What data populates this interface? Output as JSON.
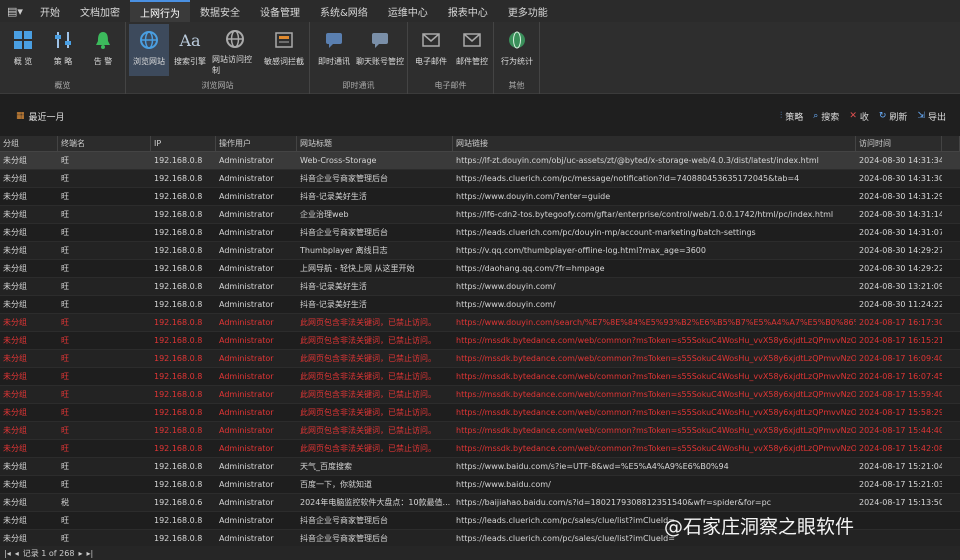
{
  "menu": {
    "items": [
      {
        "label": "开始",
        "active": false
      },
      {
        "label": "文档加密",
        "active": false
      },
      {
        "label": "上网行为",
        "active": true
      },
      {
        "label": "数据安全",
        "active": false
      },
      {
        "label": "设备管理",
        "active": false
      },
      {
        "label": "系统&网络",
        "active": false
      },
      {
        "label": "运维中心",
        "active": false
      },
      {
        "label": "报表中心",
        "active": false
      },
      {
        "label": "更多功能",
        "active": false
      }
    ]
  },
  "ribbon": {
    "groups": [
      {
        "label": "概览",
        "buttons": [
          {
            "label": "概 览",
            "icon": "grid-icon"
          },
          {
            "label": "策 略",
            "icon": "sliders-icon"
          },
          {
            "label": "告 警",
            "icon": "bell-icon"
          }
        ]
      },
      {
        "label": "浏览网站",
        "buttons": [
          {
            "label": "浏览网站",
            "icon": "globe-icon",
            "selected": true
          },
          {
            "label": "搜索引擎",
            "icon": "font-icon"
          },
          {
            "label": "网站访问控制",
            "icon": "globe-lock-icon"
          },
          {
            "label": "敏感词拦截",
            "icon": "filter-icon"
          }
        ]
      },
      {
        "label": "即时通讯",
        "buttons": [
          {
            "label": "即时通讯",
            "icon": "chat-icon"
          },
          {
            "label": "聊天账号管控",
            "icon": "chat-control-icon"
          }
        ]
      },
      {
        "label": "电子邮件",
        "buttons": [
          {
            "label": "电子邮件",
            "icon": "mail-icon"
          },
          {
            "label": "邮件管控",
            "icon": "mail-control-icon"
          }
        ]
      },
      {
        "label": "其他",
        "buttons": [
          {
            "label": "行为统计",
            "icon": "stats-globe-icon"
          }
        ]
      }
    ]
  },
  "toolbar": {
    "range_label": "最近一月",
    "strategy_label": "策略",
    "search_label": "搜索",
    "clear_label": "收",
    "refresh_label": "刷新",
    "export_label": "导出"
  },
  "table": {
    "headers": [
      "分组",
      "终端名",
      "IP",
      "操作用户",
      "网站标题",
      "网站链接",
      "访问时间"
    ],
    "rows": [
      {
        "group": "未分组",
        "term": "旺",
        "ip": "192.168.0.8",
        "user": "Administrator",
        "title": "Web-Cross-Storage",
        "url": "https://lf-zt.douyin.com/obj/uc-assets/zt/@byted/x-storage-web/4.0.3/dist/latest/index.html",
        "time": "2024-08-30 14:31:34",
        "style": "sel"
      },
      {
        "group": "未分组",
        "term": "旺",
        "ip": "192.168.0.8",
        "user": "Administrator",
        "title": "抖音企业号商家管理后台",
        "url": "https://leads.cluerich.com/pc/message/notification?id=740880453635172045&tab=4",
        "time": "2024-08-30 14:31:30",
        "style": ""
      },
      {
        "group": "未分组",
        "term": "旺",
        "ip": "192.168.0.8",
        "user": "Administrator",
        "title": "抖音-记录美好生活",
        "url": "https://www.douyin.com/?enter=guide",
        "time": "2024-08-30 14:31:29",
        "style": ""
      },
      {
        "group": "未分组",
        "term": "旺",
        "ip": "192.168.0.8",
        "user": "Administrator",
        "title": "企业治理web",
        "url": "https://lf6-cdn2-tos.bytegoofy.com/gftar/enterprise/control/web/1.0.0.1742/html/pc/index.html",
        "time": "2024-08-30 14:31:14",
        "style": ""
      },
      {
        "group": "未分组",
        "term": "旺",
        "ip": "192.168.0.8",
        "user": "Administrator",
        "title": "抖音企业号商家管理后台",
        "url": "https://leads.cluerich.com/pc/douyin-mp/account-marketing/batch-settings",
        "time": "2024-08-30 14:31:07",
        "style": ""
      },
      {
        "group": "未分组",
        "term": "旺",
        "ip": "192.168.0.8",
        "user": "Administrator",
        "title": "Thumbplayer 离线日志",
        "url": "https://v.qq.com/thumbplayer-offline-log.html?max_age=3600",
        "time": "2024-08-30 14:29:27",
        "style": ""
      },
      {
        "group": "未分组",
        "term": "旺",
        "ip": "192.168.0.8",
        "user": "Administrator",
        "title": "上网导航 - 轻快上网 从这里开始",
        "url": "https://daohang.qq.com/?fr=hmpage",
        "time": "2024-08-30 14:29:22",
        "style": ""
      },
      {
        "group": "未分组",
        "term": "旺",
        "ip": "192.168.0.8",
        "user": "Administrator",
        "title": "抖音-记录美好生活",
        "url": "https://www.douyin.com/",
        "time": "2024-08-30 13:21:09",
        "style": ""
      },
      {
        "group": "未分组",
        "term": "旺",
        "ip": "192.168.0.8",
        "user": "Administrator",
        "title": "抖音-记录美好生活",
        "url": "https://www.douyin.com/",
        "time": "2024-08-30 11:24:22",
        "style": ""
      },
      {
        "group": "未分组",
        "term": "旺",
        "ip": "192.168.0.8",
        "user": "Administrator",
        "title": "此网页包含非法关键词，已禁止访问。",
        "url": "https://www.douyin.com/search/%E7%8E%84%E5%93%B2%E6%B5%B7%E5%A4%A7%E5%B0%86%E6...",
        "time": "2024-08-17 16:17:30",
        "style": "warn"
      },
      {
        "group": "未分组",
        "term": "旺",
        "ip": "192.168.0.8",
        "user": "Administrator",
        "title": "此网页包含非法关键词，已禁止访问。",
        "url": "https://mssdk.bytedance.com/web/common?msToken=s55SokuC4WosHu_vvX58y6xjdtLzQPmvvNzO...",
        "time": "2024-08-17 16:15:21",
        "style": "warn"
      },
      {
        "group": "未分组",
        "term": "旺",
        "ip": "192.168.0.8",
        "user": "Administrator",
        "title": "此网页包含非法关键词，已禁止访问。",
        "url": "https://mssdk.bytedance.com/web/common?msToken=s55SokuC4WosHu_vvX58y6xjdtLzQPmvvNzO...",
        "time": "2024-08-17 16:09:40",
        "style": "warn"
      },
      {
        "group": "未分组",
        "term": "旺",
        "ip": "192.168.0.8",
        "user": "Administrator",
        "title": "此网页包含非法关键词，已禁止访问。",
        "url": "https://mssdk.bytedance.com/web/common?msToken=s55SokuC4WosHu_vvX58y6xjdtLzQPmvvNzO...",
        "time": "2024-08-17 16:07:45",
        "style": "warn"
      },
      {
        "group": "未分组",
        "term": "旺",
        "ip": "192.168.0.8",
        "user": "Administrator",
        "title": "此网页包含非法关键词，已禁止访问。",
        "url": "https://mssdk.bytedance.com/web/common?msToken=s55SokuC4WosHu_vvX58y6xjdtLzQPmvvNzO...",
        "time": "2024-08-17 15:59:40",
        "style": "warn"
      },
      {
        "group": "未分组",
        "term": "旺",
        "ip": "192.168.0.8",
        "user": "Administrator",
        "title": "此网页包含非法关键词，已禁止访问。",
        "url": "https://mssdk.bytedance.com/web/common?msToken=s55SokuC4WosHu_vvX58y6xjdtLzQPmvvNzO...",
        "time": "2024-08-17 15:58:29",
        "style": "warn"
      },
      {
        "group": "未分组",
        "term": "旺",
        "ip": "192.168.0.8",
        "user": "Administrator",
        "title": "此网页包含非法关键词，已禁止访问。",
        "url": "https://mssdk.bytedance.com/web/common?msToken=s55SokuC4WosHu_vvX58y6xjdtLzQPmvvNzO...",
        "time": "2024-08-17 15:44:40",
        "style": "warn"
      },
      {
        "group": "未分组",
        "term": "旺",
        "ip": "192.168.0.8",
        "user": "Administrator",
        "title": "此网页包含非法关键词，已禁止访问。",
        "url": "https://mssdk.bytedance.com/web/common?msToken=s55SokuC4WosHu_vvX58y6xjdtLzQPmvvNzO...",
        "time": "2024-08-17 15:42:08",
        "style": "warn"
      },
      {
        "group": "未分组",
        "term": "旺",
        "ip": "192.168.0.8",
        "user": "Administrator",
        "title": "天气_百度搜索",
        "url": "https://www.baidu.com/s?ie=UTF-8&wd=%E5%A4%A9%E6%B0%94",
        "time": "2024-08-17 15:21:04",
        "style": ""
      },
      {
        "group": "未分组",
        "term": "旺",
        "ip": "192.168.0.8",
        "user": "Administrator",
        "title": "百度一下，你就知道",
        "url": "https://www.baidu.com/",
        "time": "2024-08-17 15:21:03",
        "style": ""
      },
      {
        "group": "未分组",
        "term": "税",
        "ip": "192.168.0.6",
        "user": "Administrator",
        "title": "2024年电脑监控软件大盘点：10款最值...",
        "url": "https://baijiahao.baidu.com/s?id=1802179308812351540&wfr=spider&for=pc",
        "time": "2024-08-17 15:13:50",
        "style": ""
      },
      {
        "group": "未分组",
        "term": "旺",
        "ip": "192.168.0.8",
        "user": "Administrator",
        "title": "抖音企业号商家管理后台",
        "url": "https://leads.cluerich.com/pc/sales/clue/list?imClueId=",
        "time": "",
        "style": ""
      },
      {
        "group": "未分组",
        "term": "旺",
        "ip": "192.168.0.8",
        "user": "Administrator",
        "title": "抖音企业号商家管理后台",
        "url": "https://leads.cluerich.com/pc/sales/clue/list?imClueId=",
        "time": "",
        "style": ""
      }
    ]
  },
  "status": {
    "records": "记录 1 of 268"
  },
  "watermark": "@石家庄洞察之眼软件",
  "colors": {
    "accent": "#4a90e2",
    "warn": "#e03535"
  }
}
